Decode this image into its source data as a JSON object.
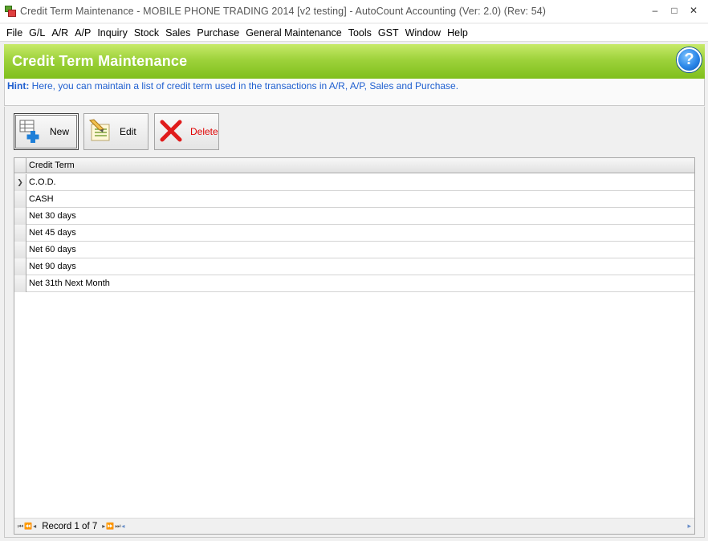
{
  "window": {
    "title": "Credit Term Maintenance - MOBILE PHONE TRADING 2014 [v2 testing] - AutoCount Accounting (Ver: 2.0) (Rev: 54)",
    "controls": {
      "minimize": "–",
      "maximize": "□",
      "close": "✕"
    }
  },
  "menu": [
    "File",
    "G/L",
    "A/R",
    "A/P",
    "Inquiry",
    "Stock",
    "Sales",
    "Purchase",
    "General Maintenance",
    "Tools",
    "GST",
    "Window",
    "Help"
  ],
  "banner": {
    "title": "Credit Term Maintenance",
    "help_icon": "?"
  },
  "hint": {
    "label": "Hint:",
    "text": " Here, you can maintain a list of credit term used in the transactions in A/R, A/P, Sales and Purchase."
  },
  "toolbar": {
    "new_label": "New",
    "edit_label": "Edit",
    "delete_label": "Delete"
  },
  "grid": {
    "column_header": "Credit Term",
    "current_row_marker": "❯",
    "rows": [
      "C.O.D.",
      "CASH",
      "Net 30 days",
      "Net 45 days",
      "Net 60 days",
      "Net 90 days",
      "Net 31th Next Month"
    ]
  },
  "navigator": {
    "first": "⏮",
    "prev_page": "⏪",
    "prev": "◂",
    "record_text": "Record 1 of 7",
    "next": "▸",
    "next_page": "⏩",
    "last": "⏭",
    "scroll_left": "◂",
    "scroll_right": "▸"
  },
  "colors": {
    "banner_green": "#9ed23b",
    "hint_blue": "#2060d0",
    "delete_red": "#e00000"
  }
}
